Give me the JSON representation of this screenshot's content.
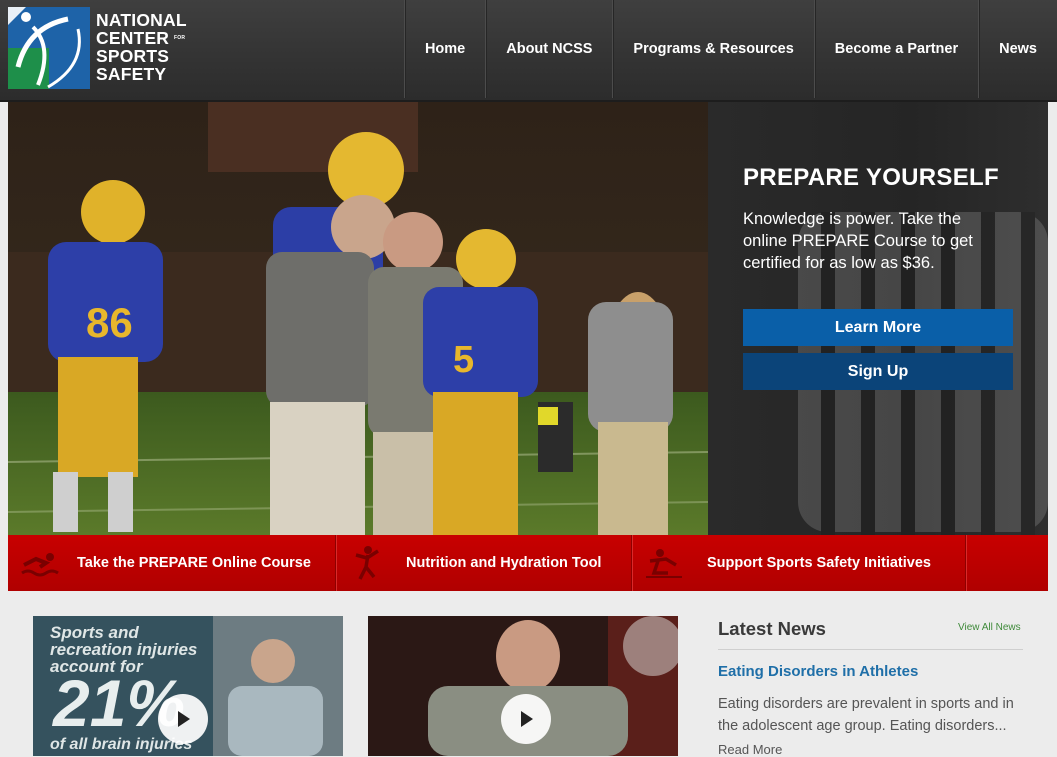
{
  "logo": {
    "line1": "NATIONAL",
    "line2": "CENTER",
    "line3": "SPORTS",
    "line4": "SAFETY",
    "for": "FOR"
  },
  "nav": [
    {
      "label": "Home"
    },
    {
      "label": "About NCSS"
    },
    {
      "label": "Programs & Resources"
    },
    {
      "label": "Become a Partner"
    },
    {
      "label": "News"
    }
  ],
  "hero": {
    "title": "PREPARE YOURSELF",
    "text": "Knowledge is power. Take the online PREPARE Course to get certified for as low as $36.",
    "learn_more": "Learn More",
    "sign_up": "Sign Up",
    "jersey_a": "86",
    "jersey_b": "5"
  },
  "redbar": [
    {
      "label": "Take the PREPARE Online Course",
      "icon": "swimmer-icon"
    },
    {
      "label": "Nutrition and Hydration Tool",
      "icon": "athlete-icon"
    },
    {
      "label": "Support Sports Safety Initiatives",
      "icon": "injured-player-icon"
    }
  ],
  "video1": {
    "line1": "Sports and",
    "line2": "recreation injuries",
    "line3": "account for",
    "big": "21%",
    "line4": "of all brain injuries"
  },
  "news": {
    "title": "Latest News",
    "view_all": "View All News",
    "headline": "Eating Disorders in Athletes",
    "body": "Eating disorders are prevalent in sports and in the adolescent age group. Eating disorders...",
    "read_more": "Read More"
  },
  "colors": {
    "header": "#333333",
    "accent_red": "#c00000",
    "learn_blue": "#0a5fa8",
    "sign_blue": "#0b4479",
    "link_blue": "#1f6fa8"
  }
}
